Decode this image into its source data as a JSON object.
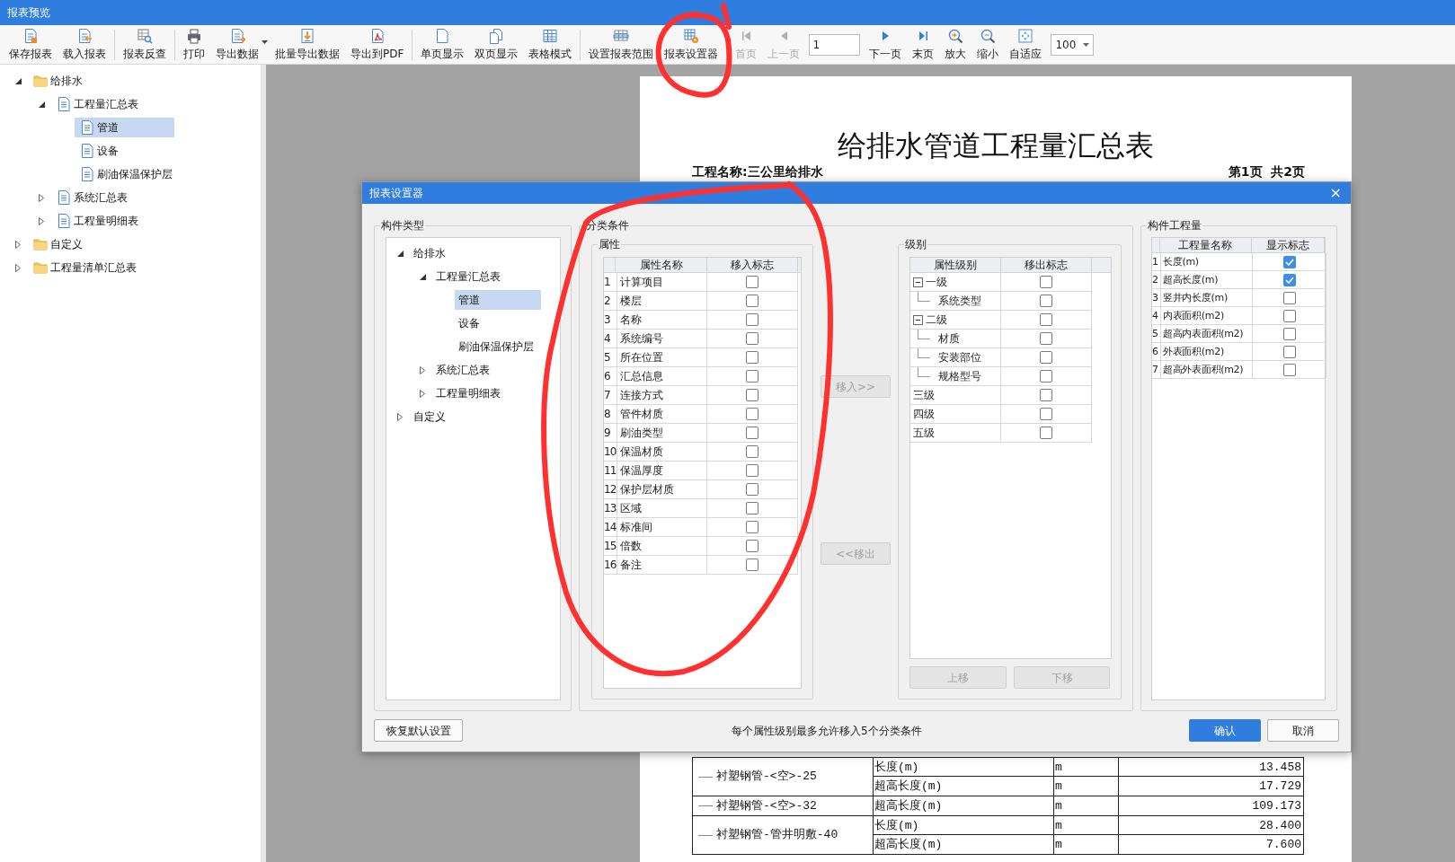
{
  "window": {
    "title": "报表预览"
  },
  "toolbar": [
    {
      "kind": "button",
      "label": "保存报表",
      "disabled": false
    },
    {
      "kind": "button",
      "label": "载入报表",
      "disabled": false
    },
    {
      "kind": "separator"
    },
    {
      "kind": "button",
      "label": "报表反查",
      "disabled": false
    },
    {
      "kind": "separator"
    },
    {
      "kind": "button",
      "label": "打印",
      "disabled": false
    },
    {
      "kind": "button",
      "label": "导出数据",
      "disabled": false,
      "has_dropdown": true
    },
    {
      "kind": "button",
      "label": "批量导出数据",
      "disabled": false
    },
    {
      "kind": "button",
      "label": "导出到PDF",
      "disabled": false
    },
    {
      "kind": "separator"
    },
    {
      "kind": "button",
      "label": "单页显示",
      "disabled": false
    },
    {
      "kind": "button",
      "label": "双页显示",
      "disabled": false
    },
    {
      "kind": "button",
      "label": "表格模式",
      "disabled": false
    },
    {
      "kind": "separator"
    },
    {
      "kind": "button",
      "label": "设置报表范围",
      "disabled": false
    },
    {
      "kind": "button",
      "label": "报表设置器",
      "disabled": false
    },
    {
      "kind": "separator"
    },
    {
      "kind": "button",
      "label": "首页",
      "disabled": true
    },
    {
      "kind": "button",
      "label": "上一页",
      "disabled": true
    },
    {
      "kind": "page_field",
      "value": "1"
    },
    {
      "kind": "button",
      "label": "下一页",
      "disabled": false
    },
    {
      "kind": "button",
      "label": "末页",
      "disabled": false
    },
    {
      "kind": "button",
      "label": "放大",
      "disabled": false
    },
    {
      "kind": "button",
      "label": "缩小",
      "disabled": false
    },
    {
      "kind": "button",
      "label": "自适应",
      "disabled": false
    },
    {
      "kind": "zoom_select",
      "value": "100"
    }
  ],
  "sidebar": {
    "tree": [
      {
        "label": "给排水",
        "kind": "folder",
        "expanded": true,
        "selected": false,
        "children": [
          {
            "label": "工程量汇总表",
            "kind": "report",
            "expanded": true,
            "selected": false,
            "children": [
              {
                "label": "管道",
                "kind": "report",
                "selected": true
              },
              {
                "label": "设备",
                "kind": "report",
                "selected": false
              },
              {
                "label": "刷油保温保护层",
                "kind": "report",
                "selected": false
              }
            ]
          },
          {
            "label": "系统汇总表",
            "kind": "report",
            "expanded": false,
            "selected": false
          },
          {
            "label": "工程量明细表",
            "kind": "report",
            "expanded": false,
            "selected": false
          }
        ]
      },
      {
        "label": "自定义",
        "kind": "folder",
        "expanded": false,
        "selected": false
      },
      {
        "label": "工程量清单汇总表",
        "kind": "folder",
        "expanded": false,
        "selected": false
      }
    ]
  },
  "report": {
    "title": "给排水管道工程量汇总表",
    "project": "工程名称:三公里给排水",
    "page_info": "第1页  共2页",
    "rows": [
      {
        "name": "衬塑钢管-<空>-25",
        "quantities": [
          {
            "item": "长度(m)",
            "unit": "m",
            "value": "13.458"
          },
          {
            "item": "超高长度(m)",
            "unit": "m",
            "value": "17.729"
          }
        ]
      },
      {
        "name": "衬塑钢管-<空>-32",
        "quantities": [
          {
            "item": "超高长度(m)",
            "unit": "m",
            "value": "109.173"
          }
        ]
      },
      {
        "name": "衬塑钢管-管井明敷-40",
        "quantities": [
          {
            "item": "长度(m)",
            "unit": "m",
            "value": "28.400"
          },
          {
            "item": "超高长度(m)",
            "unit": "m",
            "value": "7.600"
          }
        ]
      }
    ]
  },
  "dialog": {
    "title": "报表设置器",
    "close": "×",
    "component_type": {
      "label": "构件类型",
      "tree": [
        {
          "label": "给排水",
          "expanded": true,
          "selected": false,
          "children": [
            {
              "label": "工程量汇总表",
              "expanded": true,
              "selected": false,
              "children": [
                {
                  "label": "管道",
                  "selected": true
                },
                {
                  "label": "设备",
                  "selected": false
                },
                {
                  "label": "刷油保温保护层",
                  "selected": false
                }
              ]
            },
            {
              "label": "系统汇总表",
              "expanded": false,
              "selected": false
            },
            {
              "label": "工程量明细表",
              "expanded": false,
              "selected": false
            }
          ]
        },
        {
          "label": "自定义",
          "expanded": false,
          "selected": false
        }
      ]
    },
    "classification": {
      "label": "分类条件",
      "properties": {
        "label": "属性",
        "columns": [
          "属性名称",
          "移入标志"
        ],
        "rows": [
          {
            "index": "1",
            "name": "计算项目",
            "checked": false
          },
          {
            "index": "2",
            "name": "楼层",
            "checked": false
          },
          {
            "index": "3",
            "name": "名称",
            "checked": false
          },
          {
            "index": "4",
            "name": "系统编号",
            "checked": false
          },
          {
            "index": "5",
            "name": "所在位置",
            "checked": false
          },
          {
            "index": "6",
            "name": "汇总信息",
            "checked": false
          },
          {
            "index": "7",
            "name": "连接方式",
            "checked": false
          },
          {
            "index": "8",
            "name": "管件材质",
            "checked": false
          },
          {
            "index": "9",
            "name": "刷油类型",
            "checked": false
          },
          {
            "index": "10",
            "name": "保温材质",
            "checked": false
          },
          {
            "index": "11",
            "name": "保温厚度",
            "checked": false
          },
          {
            "index": "12",
            "name": "保护层材质",
            "checked": false
          },
          {
            "index": "13",
            "name": "区域",
            "checked": false
          },
          {
            "index": "14",
            "name": "标准间",
            "checked": false
          },
          {
            "index": "15",
            "name": "倍数",
            "checked": false
          },
          {
            "index": "16",
            "name": "备注",
            "checked": false
          }
        ]
      },
      "move_in": {
        "label": "移入>>",
        "disabled": true
      },
      "move_out": {
        "label": "<<移出",
        "disabled": true
      },
      "levels": {
        "label": "级别",
        "columns": [
          "属性级别",
          "移出标志"
        ],
        "rows": [
          {
            "name": "一级",
            "expanded": true,
            "checked": false,
            "children": [
              {
                "name": "系统类型",
                "checked": false
              }
            ]
          },
          {
            "name": "二级",
            "expanded": true,
            "checked": false,
            "children": [
              {
                "name": "材质",
                "checked": false
              },
              {
                "name": "安装部位",
                "checked": false
              },
              {
                "name": "规格型号",
                "checked": false
              }
            ]
          },
          {
            "name": "三级",
            "checked": false
          },
          {
            "name": "四级",
            "checked": false
          },
          {
            "name": "五级",
            "checked": false
          }
        ]
      },
      "move_up": {
        "label": "上移",
        "disabled": true
      },
      "move_down": {
        "label": "下移",
        "disabled": true
      }
    },
    "quantities": {
      "label": "构件工程量",
      "columns": [
        "工程量名称",
        "显示标志"
      ],
      "rows": [
        {
          "index": "1",
          "name": "长度(m)",
          "checked": true
        },
        {
          "index": "2",
          "name": "超高长度(m)",
          "checked": true
        },
        {
          "index": "3",
          "name": "竖井内长度(m)",
          "checked": false
        },
        {
          "index": "4",
          "name": "内表面积(m2)",
          "checked": false
        },
        {
          "index": "5",
          "name": "超高内表面积(m2)",
          "checked": false
        },
        {
          "index": "6",
          "name": "外表面积(m2)",
          "checked": false
        },
        {
          "index": "7",
          "name": "超高外表面积(m2)",
          "checked": false
        }
      ]
    },
    "restore_button": "恢复默认设置",
    "note": "每个属性级别最多允许移入5个分类条件",
    "ok_button": "确认",
    "cancel_button": "取消"
  }
}
